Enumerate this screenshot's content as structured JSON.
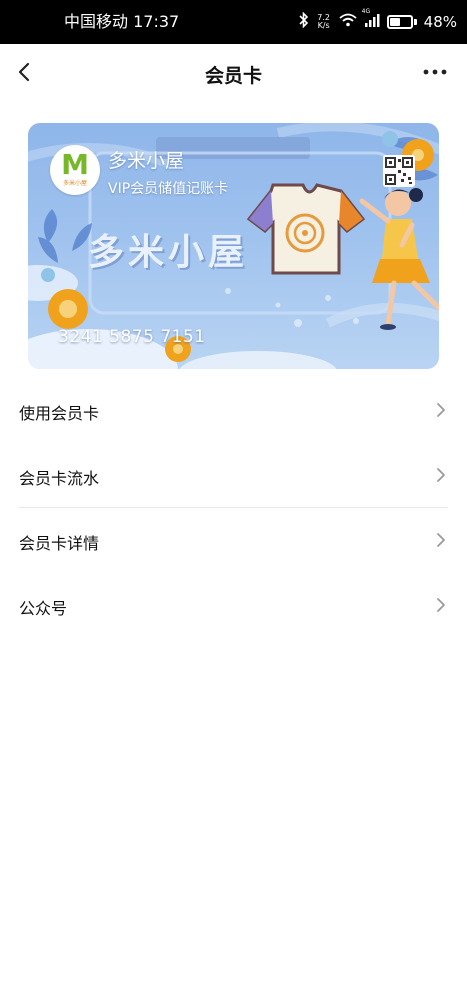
{
  "status_bar": {
    "carrier_time": "中国移动 17:37",
    "net_speed_value": "7.2",
    "net_speed_unit": "K/s",
    "signal_label": "4G",
    "battery_percent": "48%",
    "battery_level": 0.48
  },
  "nav": {
    "title": "会员卡",
    "back_icon": "chevron-left-icon",
    "more_icon": "more-dots-icon"
  },
  "card": {
    "logo_letter": "M",
    "logo_text": "多米小屋",
    "name": "多米小屋",
    "type": "VIP会员储值记账卡",
    "watermark": "多米小屋",
    "number": "3241 5875 7151",
    "qr_icon": "qr-code-icon"
  },
  "menu": {
    "items": [
      {
        "label": "使用会员卡"
      },
      {
        "label": "会员卡流水"
      },
      {
        "label": "会员卡详情"
      },
      {
        "label": "公众号"
      }
    ],
    "arrow_icon": "chevron-right-icon"
  },
  "colors": {
    "card_blue": "#9fc2ee",
    "logo_green": "#76b82a",
    "logo_orange": "#e58a2b"
  }
}
